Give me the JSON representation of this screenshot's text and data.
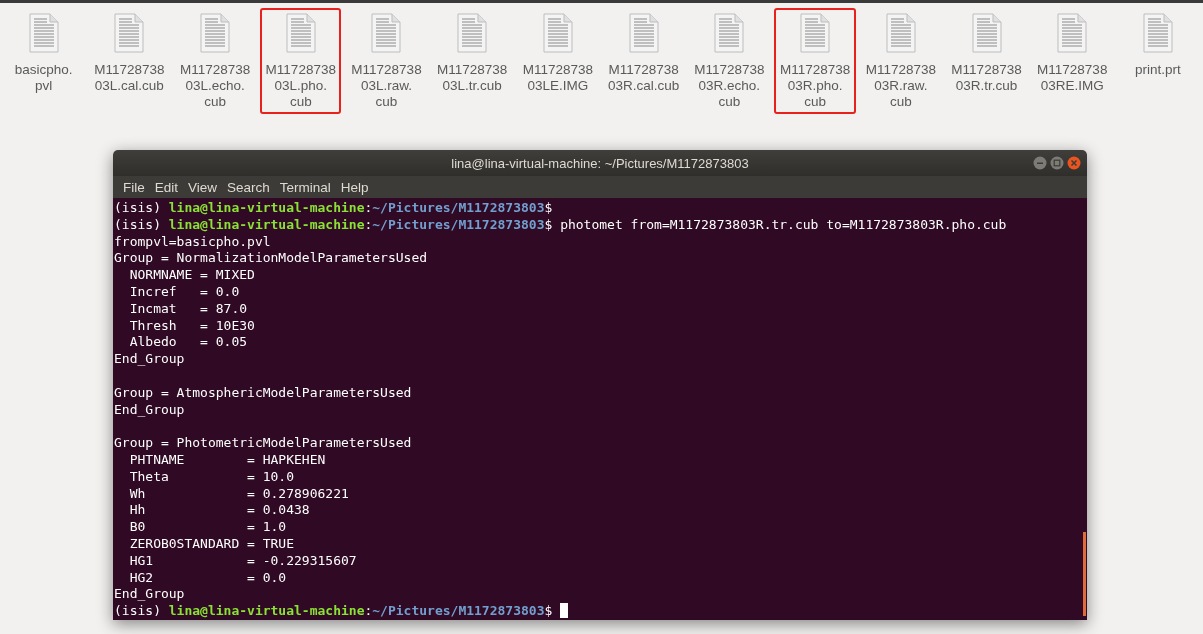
{
  "files": [
    {
      "lines": [
        "basicpho.",
        "pvl"
      ],
      "highlighted": false
    },
    {
      "lines": [
        "M11728738",
        "03L.cal.cub"
      ],
      "highlighted": false
    },
    {
      "lines": [
        "M11728738",
        "03L.echo.",
        "cub"
      ],
      "highlighted": false
    },
    {
      "lines": [
        "M11728738",
        "03L.pho.",
        "cub"
      ],
      "highlighted": true
    },
    {
      "lines": [
        "M11728738",
        "03L.raw.",
        "cub"
      ],
      "highlighted": false
    },
    {
      "lines": [
        "M11728738",
        "03L.tr.cub"
      ],
      "highlighted": false
    },
    {
      "lines": [
        "M11728738",
        "03LE.IMG"
      ],
      "highlighted": false
    },
    {
      "lines": [
        "M11728738",
        "03R.cal.cub"
      ],
      "highlighted": false
    },
    {
      "lines": [
        "M11728738",
        "03R.echo.",
        "cub"
      ],
      "highlighted": false
    },
    {
      "lines": [
        "M11728738",
        "03R.pho.",
        "cub"
      ],
      "highlighted": true
    },
    {
      "lines": [
        "M11728738",
        "03R.raw.",
        "cub"
      ],
      "highlighted": false
    },
    {
      "lines": [
        "M11728738",
        "03R.tr.cub"
      ],
      "highlighted": false
    },
    {
      "lines": [
        "M11728738",
        "03RE.IMG"
      ],
      "highlighted": false
    },
    {
      "lines": [
        "print.prt"
      ],
      "highlighted": false
    }
  ],
  "terminal": {
    "title": "lina@lina-virtual-machine: ~/Pictures/M1172873803",
    "menu": [
      "File",
      "Edit",
      "View",
      "Search",
      "Terminal",
      "Help"
    ],
    "lines": [
      {
        "kind": "prompt",
        "env": "(isis) ",
        "user": "lina@lina-virtual-machine",
        "sep": ":",
        "path": "~/Pictures/M1172873803",
        "sign": "$",
        "cursor": false
      },
      {
        "kind": "prompt",
        "env": "(isis) ",
        "user": "lina@lina-virtual-machine",
        "sep": ":",
        "path": "~/Pictures/M1172873803",
        "sign": "$",
        "command": " photomet from=M1172873803R.tr.cub to=M1172873803R.pho.cub",
        "cursor": false
      },
      {
        "kind": "text",
        "text": "frompvl=basicpho.pvl"
      },
      {
        "kind": "text",
        "text": "Group = NormalizationModelParametersUsed"
      },
      {
        "kind": "text",
        "text": "  NORMNAME = MIXED"
      },
      {
        "kind": "text",
        "text": "  Incref   = 0.0"
      },
      {
        "kind": "text",
        "text": "  Incmat   = 87.0"
      },
      {
        "kind": "text",
        "text": "  Thresh   = 10E30"
      },
      {
        "kind": "text",
        "text": "  Albedo   = 0.05"
      },
      {
        "kind": "text",
        "text": "End_Group"
      },
      {
        "kind": "blank"
      },
      {
        "kind": "text",
        "text": "Group = AtmosphericModelParametersUsed"
      },
      {
        "kind": "text",
        "text": "End_Group"
      },
      {
        "kind": "blank"
      },
      {
        "kind": "text",
        "text": "Group = PhotometricModelParametersUsed"
      },
      {
        "kind": "text",
        "text": "  PHTNAME        = HAPKEHEN"
      },
      {
        "kind": "text",
        "text": "  Theta          = 10.0"
      },
      {
        "kind": "text",
        "text": "  Wh             = 0.278906221"
      },
      {
        "kind": "text",
        "text": "  Hh             = 0.0438"
      },
      {
        "kind": "text",
        "text": "  B0             = 1.0"
      },
      {
        "kind": "text",
        "text": "  ZEROB0STANDARD = TRUE"
      },
      {
        "kind": "text",
        "text": "  HG1            = -0.229315607"
      },
      {
        "kind": "text",
        "text": "  HG2            = 0.0"
      },
      {
        "kind": "text",
        "text": "End_Group"
      },
      {
        "kind": "prompt",
        "env": "(isis) ",
        "user": "lina@lina-virtual-machine",
        "sep": ":",
        "path": "~/Pictures/M1172873803",
        "sign": "$",
        "cursor": true
      }
    ]
  }
}
